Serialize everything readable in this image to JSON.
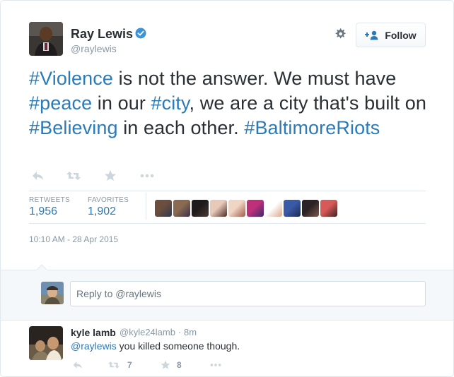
{
  "author": {
    "name": "Ray Lewis",
    "handle": "@raylewis"
  },
  "header": {
    "follow_label": "Follow"
  },
  "tweet": {
    "segments": [
      {
        "text": "#Violence",
        "link": true
      },
      {
        "text": " is not the answer. We must have ",
        "link": false
      },
      {
        "text": "#peace",
        "link": true
      },
      {
        "text": " in our ",
        "link": false
      },
      {
        "text": "#city",
        "link": true
      },
      {
        "text": ", we are a city that's built on ",
        "link": false
      },
      {
        "text": "#Believing",
        "link": true
      },
      {
        "text": " in each other. ",
        "link": false
      },
      {
        "text": "#BaltimoreRiots",
        "link": true
      }
    ]
  },
  "stats": {
    "retweets_label": "RETWEETS",
    "retweets_value": "1,956",
    "favorites_label": "FAVORITES",
    "favorites_value": "1,902"
  },
  "favoriters": [
    {
      "colors": [
        "#6b4e3d",
        "#2d3a4f"
      ]
    },
    {
      "colors": [
        "#8a6a50",
        "#3c2f4a"
      ]
    },
    {
      "colors": [
        "#1f1a1c",
        "#4a3a34"
      ]
    },
    {
      "colors": [
        "#e8c8b8",
        "#4a2e26"
      ]
    },
    {
      "colors": [
        "#f0d4c4",
        "#a05a48"
      ]
    },
    {
      "colors": [
        "#c0307a",
        "#3a2a6a"
      ]
    },
    {
      "colors": [
        "#ffffff",
        "#d9a88a"
      ]
    },
    {
      "colors": [
        "#3a5aa8",
        "#1a2a50"
      ]
    },
    {
      "colors": [
        "#2a2224",
        "#7a5a4e"
      ]
    },
    {
      "colors": [
        "#d85a58",
        "#3a2420"
      ]
    }
  ],
  "timestamp": "10:10 AM - 28 Apr 2015",
  "reply_box": {
    "placeholder": "Reply to @raylewis"
  },
  "reply": {
    "name": "kyle lamb",
    "handle": "@kyle24lamb",
    "dot": "·",
    "time": "8m",
    "mention": "@raylewis",
    "text": " you killed someone though.",
    "retweet_count": "7",
    "favorite_count": "8"
  },
  "icons": {
    "accent": "#2b7bb9",
    "muted": "#ccd6dd",
    "verified": "#3b94d9"
  }
}
